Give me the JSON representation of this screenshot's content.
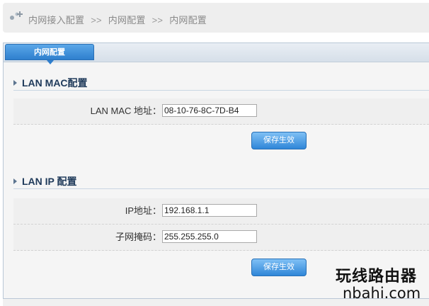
{
  "breadcrumb": {
    "items": [
      "内网接入配置",
      "内网配置",
      "内网配置"
    ],
    "separator": ">>"
  },
  "tab": {
    "label": "内网配置"
  },
  "lan_mac": {
    "title": "LAN MAC配置",
    "label": "LAN MAC 地址：",
    "value": "08-10-76-8C-7D-B4",
    "button": "保存生效"
  },
  "lan_ip": {
    "title": "LAN IP 配置",
    "ip_label": "IP地址：",
    "ip_value": "192.168.1.1",
    "mask_label": "子网掩码：",
    "mask_value": "255.255.255.0",
    "button": "保存生效"
  },
  "watermark": {
    "line1": "玩线路由器",
    "line2": "nbahi.com"
  },
  "colors": {
    "accent": "#2f86d8",
    "tab": "#2f7fce",
    "title": "#1f3a5a"
  },
  "icons": {
    "breadcrumb": "nodes-plus-icon",
    "section": "triangle-right-icon"
  }
}
